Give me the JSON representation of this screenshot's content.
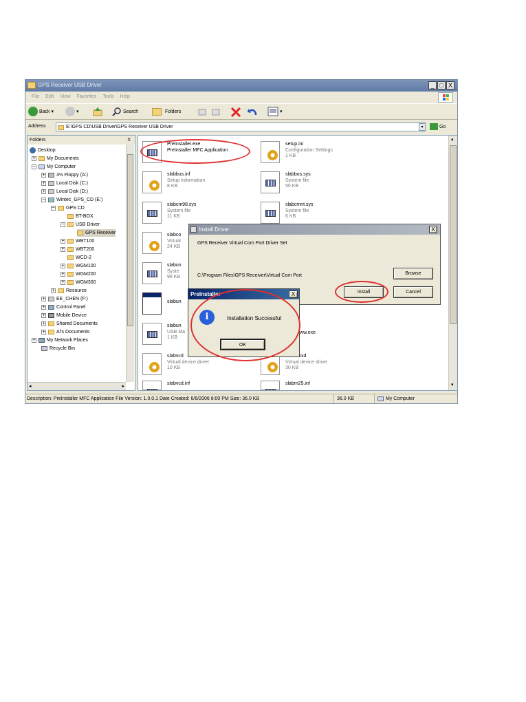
{
  "window": {
    "title": "GPS Receiver USB Driver",
    "min": "_",
    "max": "□",
    "close": "X"
  },
  "menu": [
    "File",
    "Edit",
    "View",
    "Favorites",
    "Tools",
    "Help"
  ],
  "toolbar": {
    "back": "Back",
    "search": "Search",
    "folders": "Folders"
  },
  "address": {
    "label": "Address",
    "value": "E:\\GPS CD\\USB Driver\\GPS Receiver USB Driver",
    "go": "Go"
  },
  "folders_panel": {
    "header": "Folders",
    "close": "X",
    "items": [
      "Desktop",
      "My Documents",
      "My Computer",
      "3½ Floppy (A:)",
      "Local Disk (C:)",
      "Local Disk (D:)",
      "Wintec_GPS_CD (E:)",
      "GPS CD",
      "BT-BOX",
      "USB Driver",
      "GPS Receiver",
      "WBT100",
      "WBT200",
      "WCD-2",
      "WGM100",
      "WGM200",
      "WGM300",
      "Resource",
      "EE_CHEN (F:)",
      "Control Panel",
      "Mobile Device",
      "Shared Documents",
      "Al's Documents",
      "My Network Places",
      "Recycle Bin"
    ]
  },
  "files": {
    "f1": {
      "name": "PreInstaller.exe",
      "type": "PreInstaller MFC Application",
      "size": ""
    },
    "f2": {
      "name": "setup.ini",
      "type": "Configuration Settings",
      "size": "1 KB"
    },
    "f3": {
      "name": "slabbus.inf",
      "type": "Setup Information",
      "size": "8 KB"
    },
    "f4": {
      "name": "slabbus.sys",
      "type": "System file",
      "size": "50 KB"
    },
    "f5": {
      "name": "slabcm98.sys",
      "type": "System file",
      "size": "11 KB"
    },
    "f6": {
      "name": "slabcmnt.sys",
      "type": "System file",
      "size": "6 KB"
    },
    "f7": {
      "name": "slabco",
      "type": "Virtual",
      "size": "24 KB"
    },
    "f8": {
      "name": "slabon",
      "type": "Syste",
      "size": "98 KB"
    },
    "f9": {
      "name": "slabun",
      "type": "",
      "size": ""
    },
    "f10": {
      "name": "slabun",
      "type": "USB Ma",
      "size": "1 KB"
    },
    "f10b": {
      "name": "www.exe"
    },
    "f11": {
      "name": "slabvcd",
      "type": "Virtual device driver",
      "size": "10 KB"
    },
    "f12": {
      "name": "ir.vxd",
      "type": "Virtual device driver",
      "size": "30 KB"
    },
    "f13": {
      "name": "slabvcd.inf"
    },
    "f14": {
      "name": "slabm25.inf"
    }
  },
  "status": {
    "description": "Description: PreInstaller MFC Application File Version: 1.0.0.1 Date Created: 6/6/2006 8:00 PM Size: 36.0 KB",
    "size": "36.0 KB",
    "zone": "My Computer"
  },
  "install_dialog": {
    "title": "Install Driver",
    "close": "X",
    "heading": "GPS Receiver Virtual Com Port Driver Set",
    "path": "C:\\Program Files\\GPS Receiver\\Virtual Com Port",
    "browse": "Browse",
    "install": "Install",
    "cancel": "Cancel"
  },
  "preinstaller_dialog": {
    "title": "PreInstaller",
    "close": "X",
    "icon_glyph": "i",
    "message": "Installation Successful",
    "ok": "OK"
  },
  "colors": {
    "highlight_ring": "#e03030",
    "title_active": "#0a246a"
  }
}
